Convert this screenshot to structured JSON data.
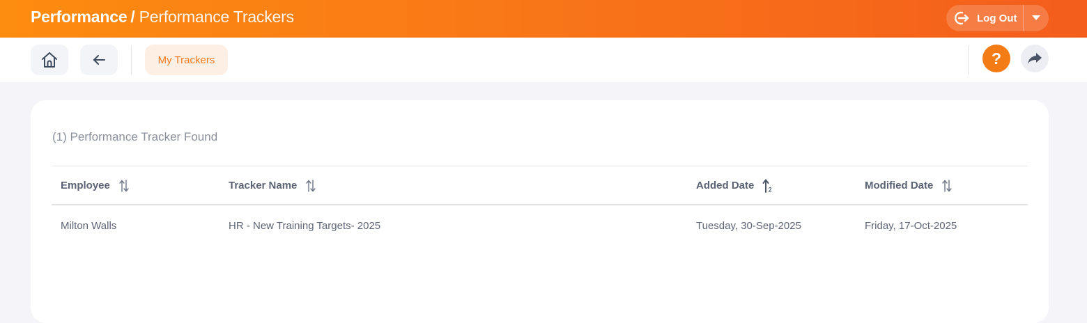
{
  "header": {
    "section": "Performance",
    "separator": "/",
    "page": "Performance Trackers",
    "logout_label": "Log Out"
  },
  "toolbar": {
    "home_icon": "home-icon",
    "back_icon": "arrow-left-icon",
    "tab_label": "My Trackers",
    "help_label": "?",
    "share_icon": "share-icon"
  },
  "results": {
    "count_text": "(1) Performance Tracker Found"
  },
  "table": {
    "columns": [
      "Employee",
      "Tracker Name",
      "Added Date",
      "Modified Date"
    ],
    "sorted_column": "Added Date",
    "rows": [
      {
        "employee": "Milton Walls",
        "tracker_name": "HR - New Training Targets- 2025",
        "added_date": "Tuesday, 30-Sep-2025",
        "modified_date": "Friday, 17-Oct-2025"
      }
    ]
  },
  "colors": {
    "brand_orange": "#f47c16",
    "tab_bg": "#fdefe3",
    "page_bg": "#f4f4f9"
  }
}
